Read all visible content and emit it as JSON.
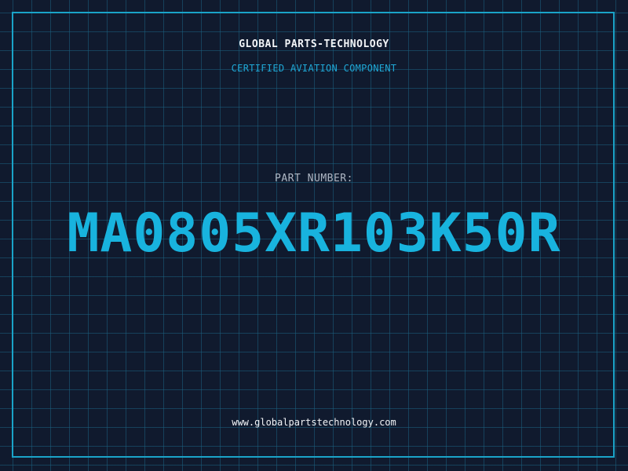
{
  "header": {
    "company": "GLOBAL PARTS-TECHNOLOGY",
    "subtitle": "CERTIFIED AVIATION COMPONENT"
  },
  "main": {
    "label": "PART NUMBER:",
    "part_number": "MA0805XR103K50R"
  },
  "footer": {
    "website": "www.globalpartstechnology.com"
  },
  "colors": {
    "background": "#101a2e",
    "grid": "#1c6080",
    "frame": "#1aa3c8",
    "accent": "#18b3de",
    "text": "#f2f4f7"
  }
}
